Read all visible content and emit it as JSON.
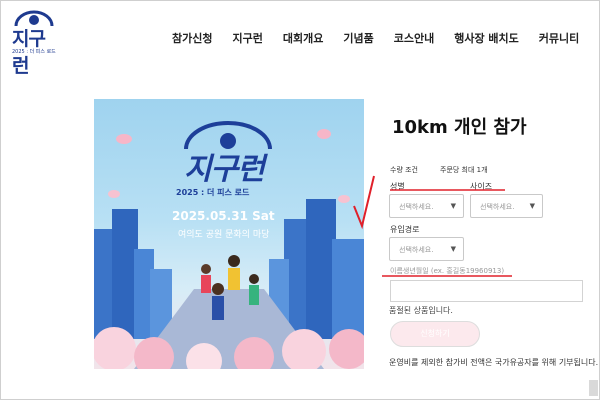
{
  "brand": {
    "logo_title": "지구런",
    "logo_sub": "2025 : 더 피스 로드"
  },
  "nav": {
    "items": [
      "참가신청",
      "지구런",
      "대회개요",
      "기념품",
      "코스안내",
      "행사장 배치도",
      "커뮤니티"
    ]
  },
  "poster": {
    "title": "지구런",
    "subtitle": "2025 : 더 피스 로드",
    "date": "2025.05.31 Sat",
    "venue": "여의도 공원 문화의 마당"
  },
  "product": {
    "title": "10km 개인 참가",
    "qty_label": "수량 조건",
    "qty_value": "주문당 최대 1개",
    "option_gender_label": "성별",
    "option_size_label": "사이즈",
    "select_placeholder": "선택하세요.",
    "option_route_label": "유입경로",
    "birth_placeholder": "이름생년월일 (ex. 홍길동19960913)",
    "soldout_text": "품절된 상품입니다.",
    "buy_label": "신청하기",
    "note": "운영비를 제외한 참가비 전액은 국가유공자를 위해 기부됩니다."
  },
  "colors": {
    "brand_blue": "#1d3f99",
    "annotation_red": "#e0202a",
    "button_pink": "#fce9ed"
  },
  "icons": {
    "select_arrow": "chevron-down-icon",
    "checkmark": "checkmark-annotation"
  }
}
